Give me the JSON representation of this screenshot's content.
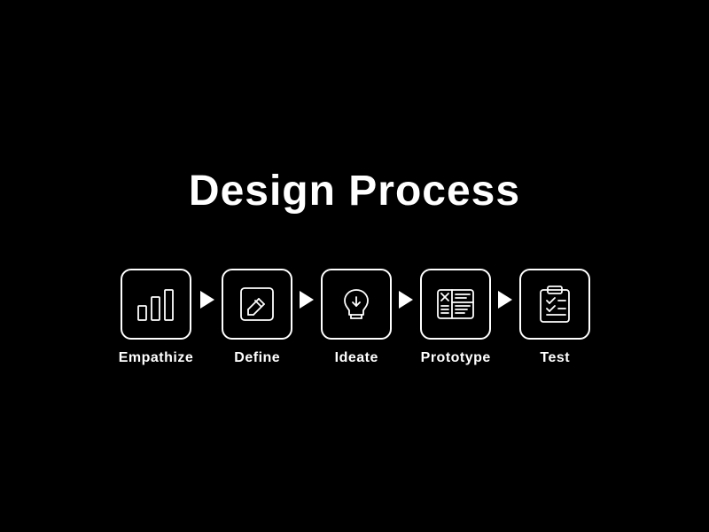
{
  "page": {
    "title": "Design Process",
    "background": "#000000"
  },
  "steps": [
    {
      "id": "empathize",
      "label": "Empathize",
      "icon": "bar-chart"
    },
    {
      "id": "define",
      "label": "Define",
      "icon": "edit"
    },
    {
      "id": "ideate",
      "label": "Ideate",
      "icon": "lightbulb"
    },
    {
      "id": "prototype",
      "label": "Prototype",
      "icon": "wireframe"
    },
    {
      "id": "test",
      "label": "Test",
      "icon": "clipboard"
    }
  ]
}
